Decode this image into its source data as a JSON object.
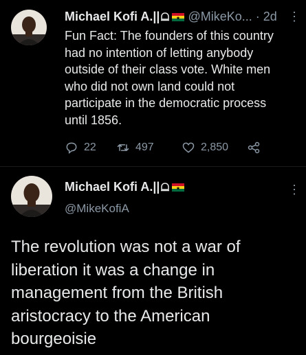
{
  "tweet1": {
    "author_name": "Michael Kofi A.||",
    "handle_truncated": "@MikeKo...",
    "separator": "·",
    "time": "2d",
    "text": "Fun Fact: The founders of this country had no intention of letting anybody outside of their class vote. White men who did not own land could not participate in the democratic process until 1856.",
    "replies": "22",
    "retweets": "497",
    "likes": "2,850",
    "more": "⋮"
  },
  "tweet2": {
    "author_name": "Michael Kofi A.||",
    "handle": "@MikeKofiA",
    "text": "The revolution was not a war of liberation it was a change in management from the British aristocracy to the American bourgeoisie",
    "more": "⋮"
  },
  "colors": {
    "background": "#000000",
    "text": "#e7e9ea",
    "muted": "#8b98a5"
  },
  "icons": [
    "avatar",
    "emblem-icon",
    "ghana-flag-icon",
    "reply-icon",
    "retweet-icon",
    "like-icon",
    "share-icon",
    "more-icon"
  ]
}
